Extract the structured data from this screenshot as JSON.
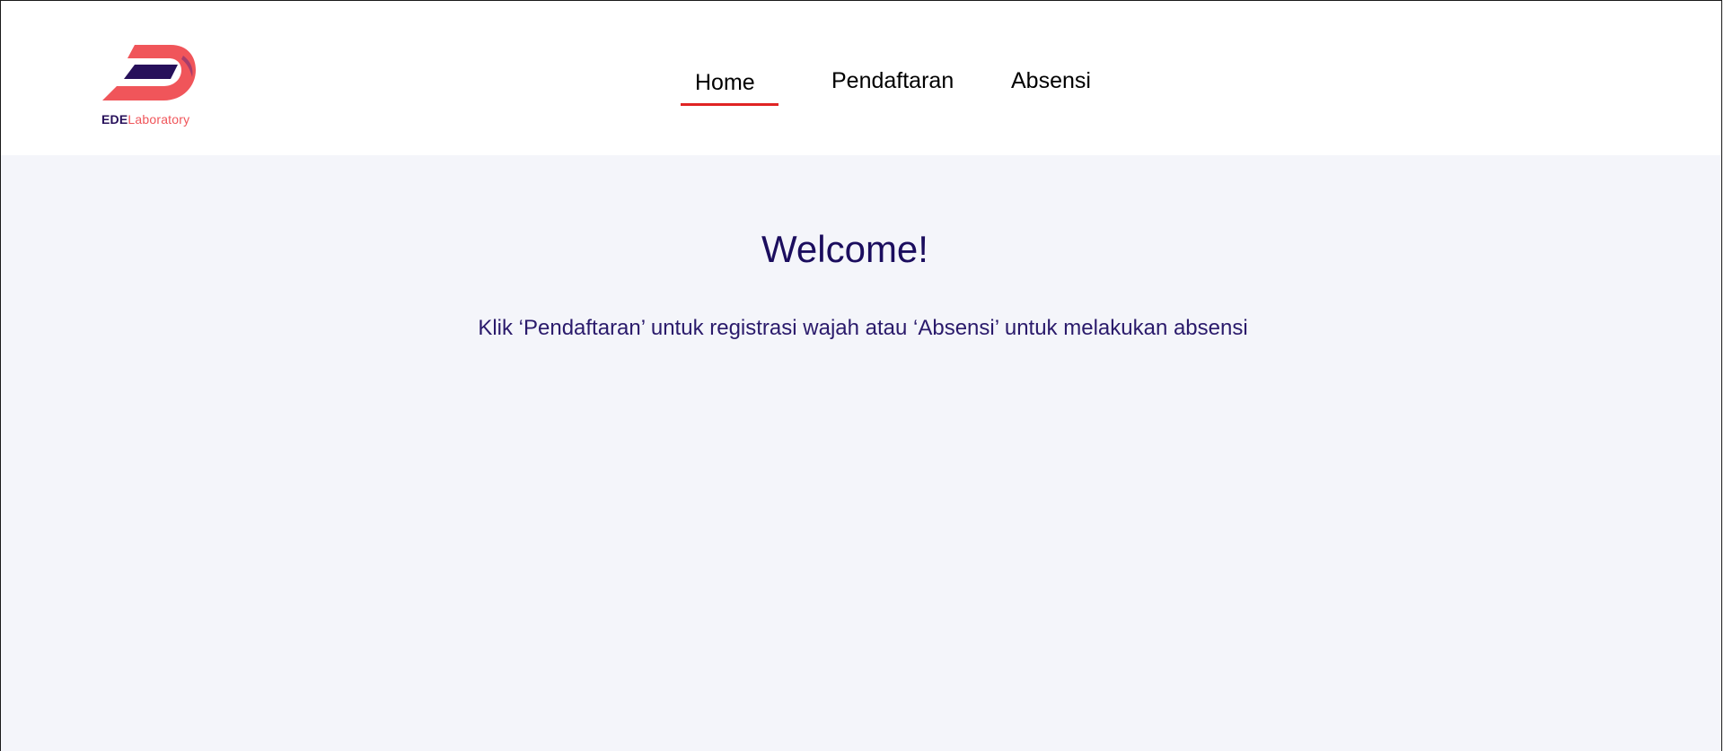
{
  "brand": {
    "logo_text_bold": "EDE",
    "logo_text_light": "Laboratory",
    "primary_color": "#27105a",
    "accent_color": "#f0555a"
  },
  "nav": {
    "items": [
      {
        "label": "Home",
        "active": true
      },
      {
        "label": "Pendaftaran",
        "active": false
      },
      {
        "label": "Absensi",
        "active": false
      }
    ],
    "active_indicator_color": "#e02424"
  },
  "main": {
    "title": "Welcome!",
    "subtitle": "Klik ‘Pendaftaran’ untuk registrasi wajah atau ‘Absensi’ untuk melakukan absensi"
  },
  "colors": {
    "page_background": "#f4f5fa",
    "header_background": "#ffffff",
    "heading_text": "#1b0d5e"
  }
}
